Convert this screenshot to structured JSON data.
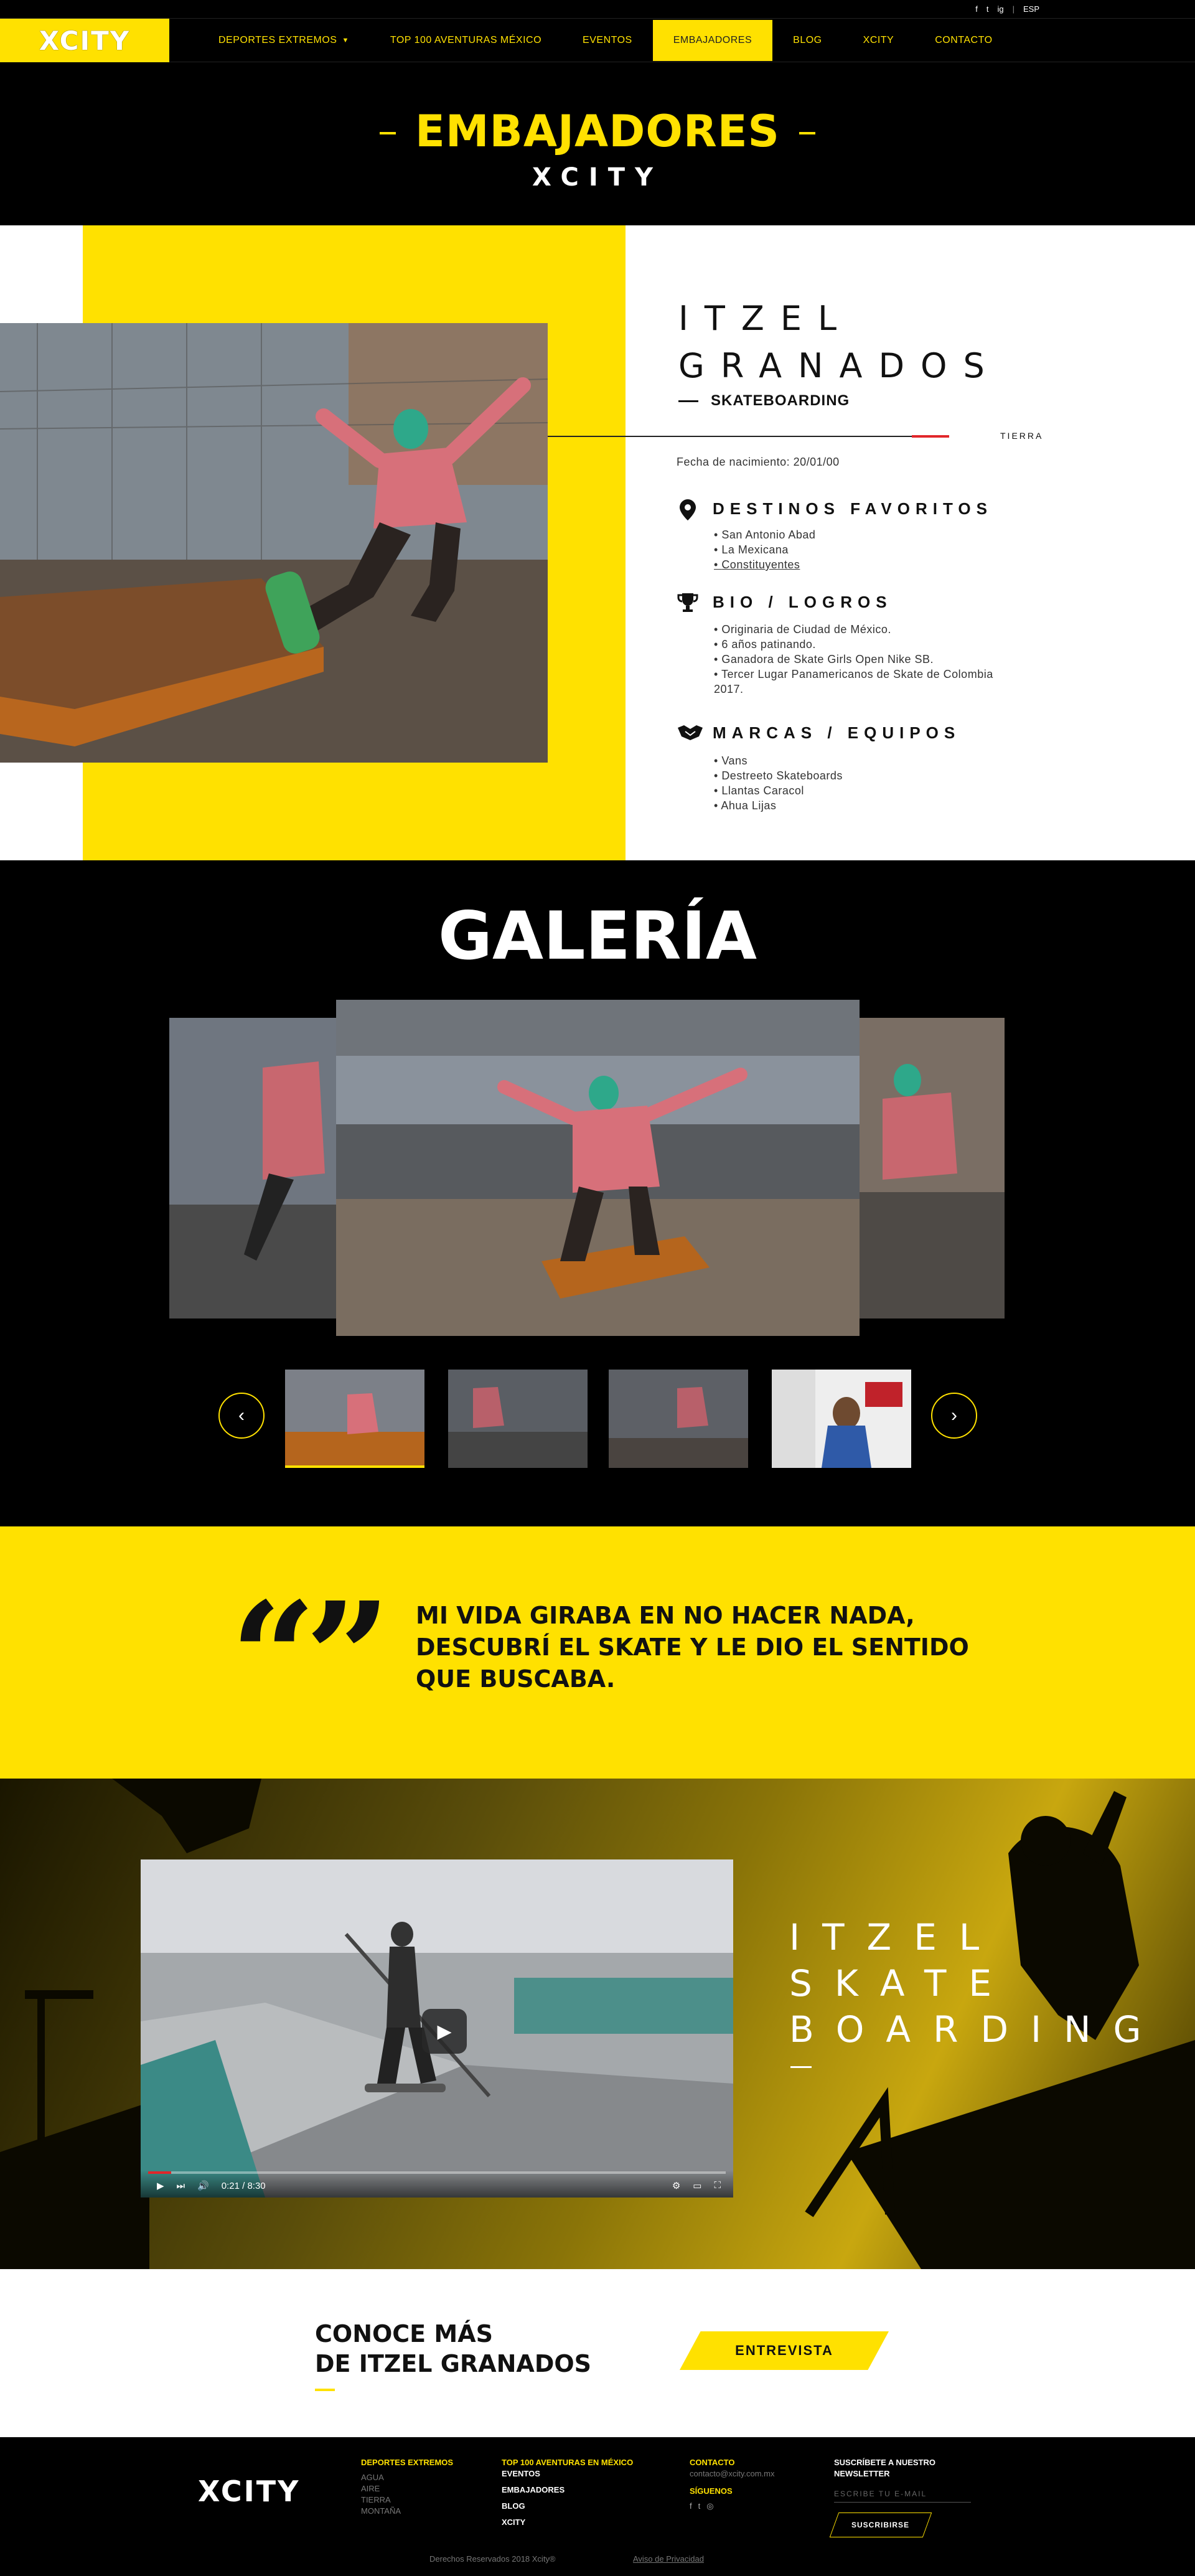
{
  "topbar": {
    "social": [
      "f",
      "t",
      "ig"
    ],
    "lang": "ESP"
  },
  "nav": {
    "logo": "XCITY",
    "items": [
      {
        "label": "DEPORTES EXTREMOS",
        "dropdown": true
      },
      {
        "label": "TOP 100 AVENTURAS MÉXICO"
      },
      {
        "label": "EVENTOS"
      },
      {
        "label": "EMBAJADORES",
        "active": true
      },
      {
        "label": "BLOG"
      },
      {
        "label": "XCITY"
      },
      {
        "label": "CONTACTO"
      }
    ]
  },
  "hero": {
    "title": "EMBAJADORES",
    "subtitle": "XCITY"
  },
  "profile": {
    "name_line1": "ITZEL",
    "name_line2": "GRANADOS",
    "sport": "SKATEBOARDING",
    "terrain": "TIERRA",
    "birth": "Fecha de nacimiento: 20/01/00",
    "destinos": {
      "title": "DESTINOS FAVORITOS",
      "icon": "map-pin-icon",
      "items": [
        "San Antonio Abad",
        "La Mexicana",
        "Constituyentes"
      ]
    },
    "bio": {
      "title": "BIO / LOGROS",
      "icon": "trophy-icon",
      "items": [
        "Originaria de Ciudad de México.",
        "6 años patinando.",
        "Ganadora de Skate Girls Open Nike SB.",
        "Tercer Lugar Panamericanos de Skate de Colombia 2017."
      ]
    },
    "marcas": {
      "title": "MARCAS / EQUIPOS",
      "icon": "handshake-icon",
      "items": [
        "Vans",
        "Destreeto Skateboards",
        "Llantas Caracol",
        "Ahua Lijas"
      ]
    }
  },
  "gallery": {
    "title": "GALERÍA",
    "prev_icon": "chevron-left-icon",
    "next_icon": "chevron-right-icon"
  },
  "quote": {
    "marks": "“”",
    "text": "MI VIDA GIRABA EN NO HACER NADA, DESCUBRÍ EL SKATE Y LE DIO EL SENTIDO QUE BUSCABA."
  },
  "video": {
    "time": "0:21 / 8:30",
    "progress": 0.04,
    "title_line1": "ITZEL",
    "title_line2": "SKATE",
    "title_line3": "BOARDING"
  },
  "conoce": {
    "line1": "CONOCE MÁS",
    "line2": "DE ITZEL GRANADOS",
    "button": "ENTREVISTA"
  },
  "footer": {
    "logo": "XCITY",
    "col1_head": "DEPORTES EXTREMOS",
    "col1_items": [
      "AGUA",
      "AIRE",
      "TIERRA",
      "MONTAÑA"
    ],
    "col2_items": [
      "TOP 100 AVENTURAS EN MÉXICO",
      "EVENTOS",
      "EMBAJADORES",
      "BLOG",
      "XCITY"
    ],
    "contact_head": "CONTACTO",
    "contact_email": "contacto@xcity.com.mx",
    "follow_head": "SÍGUENOS",
    "newsletter_head": "SUSCRÍBETE A NUESTRO NEWSLETTER",
    "newsletter_placeholder": "ESCRIBE TU E-MAIL",
    "subscribe": "SUSCRIBIRSE",
    "copyright": "Derechos Reservados 2018 Xcity®",
    "privacy": "Aviso de Privacidad"
  },
  "colors": {
    "accent": "#ffe100",
    "dark": "#000000",
    "red": "#e1262a"
  }
}
